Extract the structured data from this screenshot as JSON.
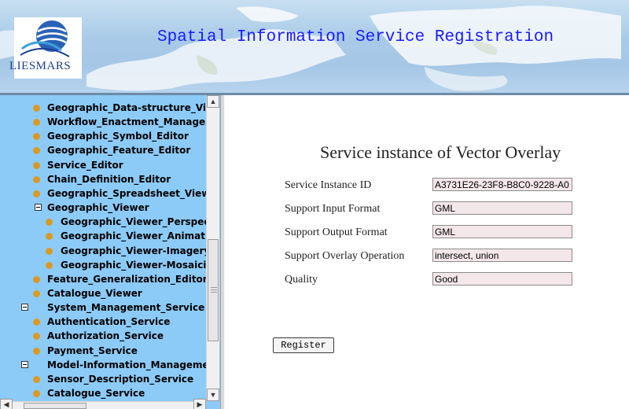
{
  "banner": {
    "logo_text": "LIESMARS",
    "title": "Spatial Information Service Registration"
  },
  "sidebar": {
    "items": [
      {
        "label": "Geographic_Data-structure_Viewer",
        "kind": "leaf",
        "level": 1
      },
      {
        "label": "Workflow_Enactment_Manager",
        "kind": "leaf",
        "level": 1
      },
      {
        "label": "Geographic_Symbol_Editor",
        "kind": "leaf",
        "level": 1
      },
      {
        "label": "Geographic_Feature_Editor",
        "kind": "leaf",
        "level": 1
      },
      {
        "label": "Service_Editor",
        "kind": "leaf",
        "level": 1
      },
      {
        "label": "Chain_Definition_Editor",
        "kind": "leaf",
        "level": 1
      },
      {
        "label": "Geographic_Spreadsheet_Viewer",
        "kind": "leaf",
        "level": 1
      },
      {
        "label": "Geographic_Viewer",
        "kind": "folder",
        "level": 1
      },
      {
        "label": "Geographic_Viewer_Perspective",
        "kind": "leaf",
        "level": 2
      },
      {
        "label": "Geographic_Viewer_Animation",
        "kind": "leaf",
        "level": 2
      },
      {
        "label": "Geographic_Viewer-Imagery",
        "kind": "leaf",
        "level": 2
      },
      {
        "label": "Geographic_Viewer-Mosaicing",
        "kind": "leaf",
        "level": 2
      },
      {
        "label": "Feature_Generalization_Editor",
        "kind": "leaf",
        "level": 1
      },
      {
        "label": "Catalogue_Viewer",
        "kind": "leaf",
        "level": 1
      },
      {
        "label": "System_Management_Service",
        "kind": "folder",
        "level": 0
      },
      {
        "label": "Authentication_Service",
        "kind": "leaf",
        "level": 1
      },
      {
        "label": "Authorization_Service",
        "kind": "leaf",
        "level": 1
      },
      {
        "label": "Payment_Service",
        "kind": "leaf",
        "level": 1
      },
      {
        "label": "Model-Information_Management",
        "kind": "folder",
        "level": 0
      },
      {
        "label": "Sensor_Description_Service",
        "kind": "leaf",
        "level": 1
      },
      {
        "label": "Catalogue_Service",
        "kind": "leaf",
        "level": 1
      }
    ]
  },
  "form": {
    "title": "Service instance of Vector Overlay",
    "fields": [
      {
        "label": "Service Instance ID",
        "value": "A3731E26-23F8-B8C0-9228-A0"
      },
      {
        "label": "Support Input Format",
        "value": "GML"
      },
      {
        "label": "Support Output Format",
        "value": "GML"
      },
      {
        "label": "Support Overlay Operation",
        "value": "intersect, union"
      },
      {
        "label": "Quality",
        "value": "Good"
      }
    ],
    "register_label": "Register"
  },
  "icons": {
    "leaf_bullet": "orange-dot-icon",
    "folder_toggle": "collapse-minus-icon",
    "scroll_up": "arrow-up-icon",
    "scroll_down": "arrow-down-icon",
    "scroll_left": "arrow-left-icon",
    "scroll_right": "arrow-right-icon"
  },
  "colors": {
    "sidebar_bg": "#8ccbf7",
    "bullet": "#d89a25",
    "title_blue": "#1a1aff",
    "input_bg": "#f3e7ea"
  }
}
